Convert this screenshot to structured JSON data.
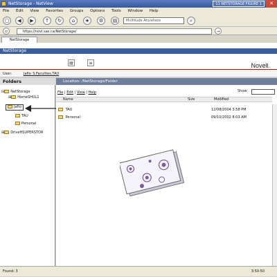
{
  "window": {
    "title": "NetStorage - NetView",
    "overlay_label": "11 NETSTORAGE FIGURE 1"
  },
  "menu": [
    "File",
    "Edit",
    "View",
    "Favorites",
    "Groups",
    "Options",
    "Tools",
    "Window",
    "Help"
  ],
  "toolbar": {
    "search_placeholder": "Multitude Anywhere"
  },
  "address": {
    "url": "https://novl.sas.ca/NetStorage/"
  },
  "tab": {
    "label": "NetStorage"
  },
  "app": {
    "header_title": "NetStorage",
    "brand": "Novell."
  },
  "user": {
    "label": "User:",
    "value": "Jafio_S.Faculties.TAU"
  },
  "folders": {
    "title": "Folders",
    "items": [
      {
        "label": "NetStorage"
      },
      {
        "label": "HomeSHUL1"
      },
      {
        "label": "Jafio"
      },
      {
        "label": "TAU"
      },
      {
        "label": "Personal"
      },
      {
        "label": "DriveHSUPERSTOR"
      }
    ]
  },
  "main": {
    "location": "Location: /NetStorage/Folder",
    "actions": [
      "File",
      "Edit",
      "View",
      "Help"
    ],
    "show_label": "Show:",
    "columns": [
      "Name",
      "Size",
      "Modified"
    ],
    "rows": [
      {
        "name": "TAU",
        "size": "",
        "modified": "12/08/2004 3:58 PM"
      },
      {
        "name": "Personal",
        "size": "",
        "modified": "09/10/2002 8:03 AM"
      }
    ]
  },
  "status": {
    "left": "Found: 3",
    "right": "3:50:50"
  },
  "colors": {
    "title_bar": "#3557a0",
    "netstorage_bar": "#3a5f9c",
    "location_bar": "#6d7f9c",
    "brand_rule": "#bb0000",
    "folder_icon": "#f3d77a"
  }
}
